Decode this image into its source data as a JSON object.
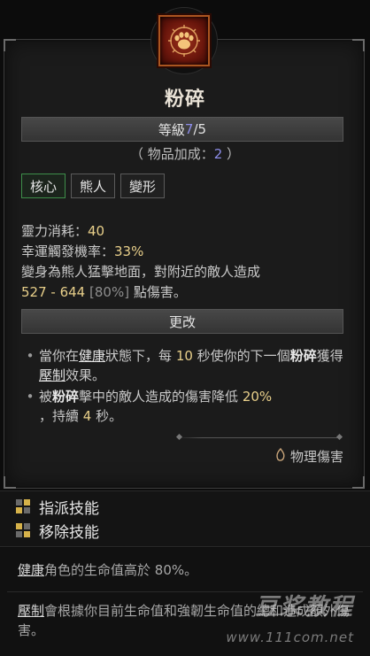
{
  "skill": {
    "icon": "bear-paw-icon",
    "title": "粉碎",
    "rank_label": "等級 ",
    "rank_current": "7",
    "rank_sep": "/",
    "rank_max": "5",
    "item_bonus_prefix": "（ 物品加成：",
    "item_bonus_value": "2",
    "item_bonus_suffix": " ）",
    "tags": [
      "核心",
      "熊人",
      "變形"
    ]
  },
  "stats": {
    "spirit_cost_label": "靈力消耗：",
    "spirit_cost_value": "40",
    "lucky_hit_label": "幸運觸發機率：",
    "lucky_hit_value": "33%",
    "desc_line1": "變身為熊人猛擊地面，對附近的敵人造成",
    "damage_range": "527 - 644",
    "damage_pct": "[80%]",
    "damage_suffix": " 點傷害。"
  },
  "modifiers": {
    "header": "更改",
    "mod1": {
      "p1": "當你在",
      "kw1": "健康",
      "p2": "狀態下，每 ",
      "num1": "10",
      "p3": " 秒使你的下一",
      "p4": "個",
      "strong1": "粉碎",
      "p5": "獲得",
      "kw2": "壓制",
      "p6": "效果。"
    },
    "mod2": {
      "p1": "被",
      "strong1": "粉碎",
      "p2": "擊中的敵人造成的傷害降低 ",
      "num1": "20%",
      "p3": "，持續 ",
      "num2": "4",
      "p4": " 秒。"
    }
  },
  "damage_type": {
    "icon": "physical-damage-icon",
    "label": "物理傷害"
  },
  "actions": {
    "assign": "指派技能",
    "remove": "移除技能"
  },
  "glossary": {
    "healthy_term": "健康",
    "healthy_text": "角色的生命值高於 80%。",
    "overpower_term": "壓制",
    "overpower_text": "會根據你目前生命值和強韌生命值的總和造成額外傷害。"
  },
  "watermark": {
    "text": "豆浆教程",
    "url": "www.111com.net"
  },
  "colors": {
    "rank_current": "#8d8de8",
    "value_highlight": "#e8cf8a",
    "core_tag_border": "#3e8e4a",
    "icon_frame": "#aa5520"
  }
}
